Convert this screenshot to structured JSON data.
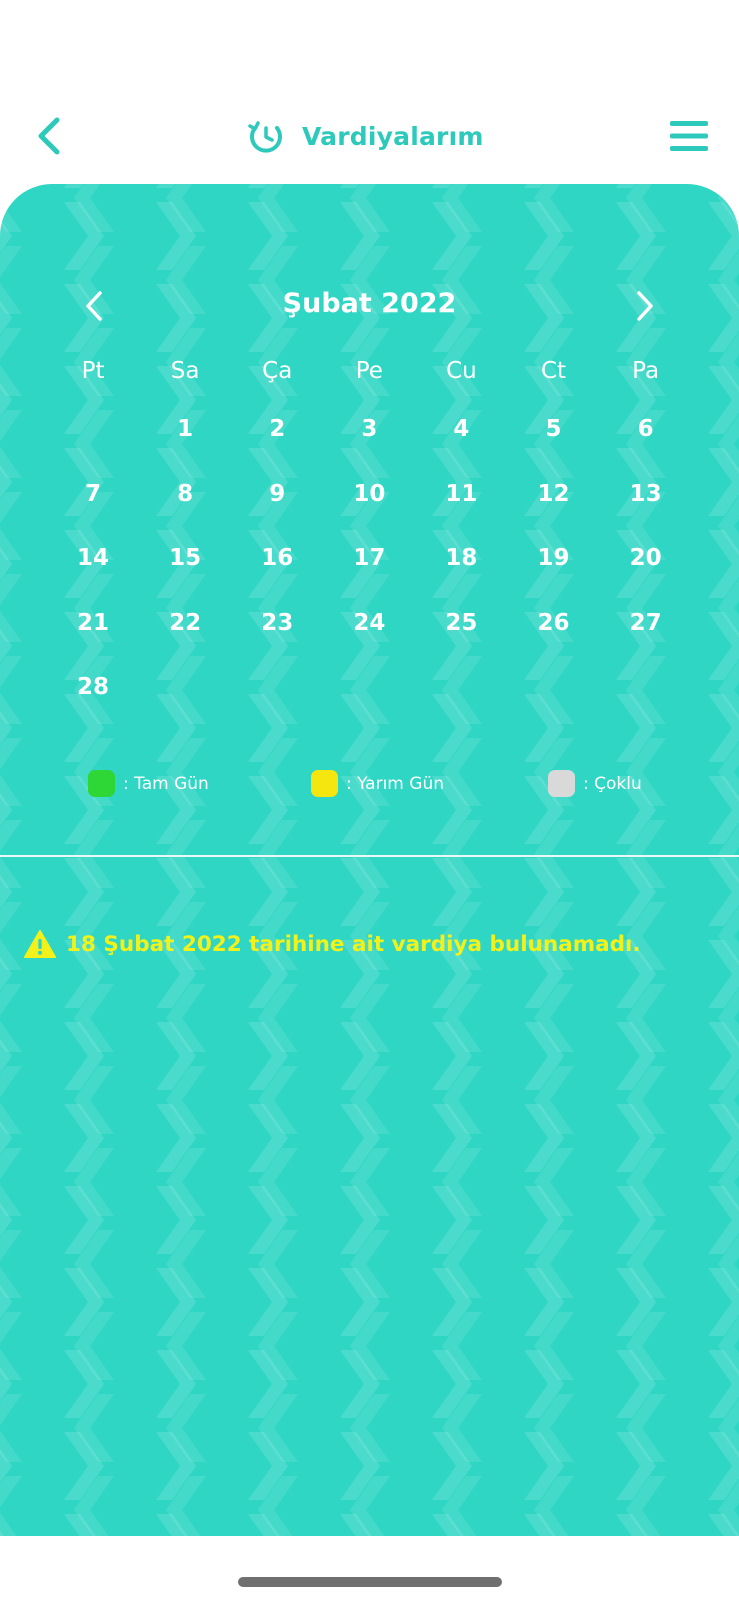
{
  "header": {
    "title": "Vardiyalarım",
    "back_icon": "chevron-left-icon",
    "title_icon": "shift-clock-icon",
    "menu_icon": "hamburger-menu-icon"
  },
  "calendar": {
    "month_label": "Şubat 2022",
    "weekdays": [
      "Pt",
      "Sa",
      "Ça",
      "Pe",
      "Cu",
      "Ct",
      "Pa"
    ],
    "days": [
      "",
      "1",
      "2",
      "3",
      "4",
      "5",
      "6",
      "7",
      "8",
      "9",
      "10",
      "11",
      "12",
      "13",
      "14",
      "15",
      "16",
      "17",
      "18",
      "19",
      "20",
      "21",
      "22",
      "23",
      "24",
      "25",
      "26",
      "27",
      "28"
    ]
  },
  "legend": {
    "full_day": {
      "label": ": Tam Gün",
      "color": "#2ed636"
    },
    "half_day": {
      "label": ": Yarım Gün",
      "color": "#f5e60f"
    },
    "multiple": {
      "label": ": Çoklu",
      "color": "#d9d9d9"
    }
  },
  "notice": {
    "text": "18 Şubat 2022 tarihine ait vardiya bulunamadı.",
    "icon": "warning-icon",
    "color": "#f2f21a"
  },
  "colors": {
    "accent": "#2dc9bb",
    "panel": "#2fd6c4"
  }
}
